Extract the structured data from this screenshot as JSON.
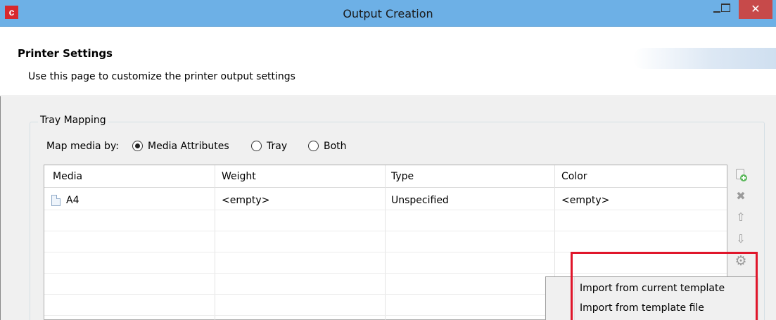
{
  "window": {
    "app_icon_letter": "c",
    "title": "Output Creation",
    "close_glyph": "✕",
    "icons": [
      "app-icon",
      "minimize-icon",
      "maximize-icon",
      "close-icon"
    ]
  },
  "header": {
    "title": "Printer Settings",
    "description": "Use this page to customize the printer output settings"
  },
  "tray_mapping": {
    "group_title": "Tray Mapping",
    "map_label": "Map media by:",
    "options": [
      {
        "label": "Media Attributes",
        "selected": true
      },
      {
        "label": "Tray",
        "selected": false
      },
      {
        "label": "Both",
        "selected": false
      }
    ],
    "table": {
      "columns": [
        "Media",
        "Weight",
        "Type",
        "Color"
      ],
      "rows": [
        {
          "media": "A4",
          "weight": "<empty>",
          "type": "Unspecified",
          "color": "<empty>"
        }
      ]
    },
    "toolbar": {
      "remove_glyph": "✖",
      "up_glyph": "⇧",
      "down_glyph": "⇩",
      "gear_glyph": "⚙",
      "icons": [
        "add-media-icon",
        "remove-icon",
        "move-up-icon",
        "move-down-icon",
        "gear-icon"
      ]
    }
  },
  "context_menu": {
    "items": [
      "Import from current template",
      "Import from template file"
    ]
  },
  "colors": {
    "title_bar": "#6db0e6",
    "close_button": "#c74a4a",
    "highlight": "#e0162b",
    "app_icon": "#d7282d"
  }
}
